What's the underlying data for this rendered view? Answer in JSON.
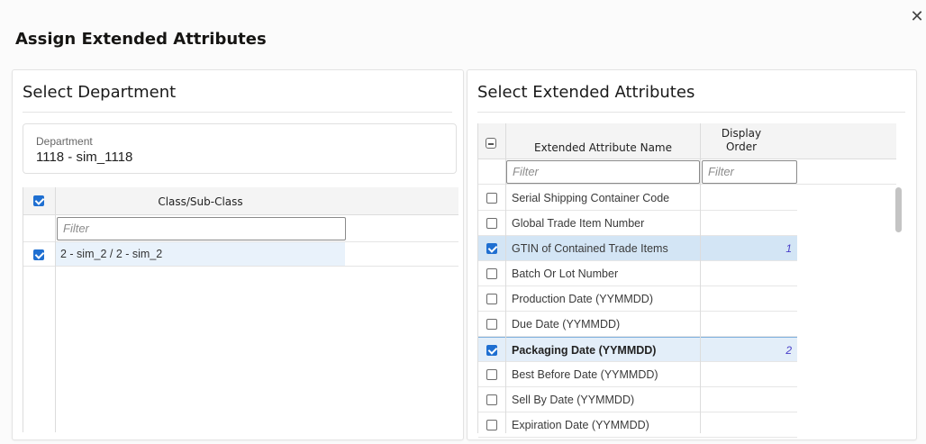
{
  "dialog": {
    "title": "Assign Extended Attributes",
    "close_icon": "close-icon"
  },
  "left_panel": {
    "title": "Select Department",
    "department": {
      "label": "Department",
      "value": "1118 - sim_1118"
    },
    "table": {
      "header_checkbox_checked": true,
      "column_header": "Class/Sub-Class",
      "filter_placeholder": "Filter",
      "rows": [
        {
          "checked": true,
          "label": "2 - sim_2 / 2 - sim_2"
        }
      ]
    }
  },
  "right_panel": {
    "title": "Select Extended Attributes",
    "table": {
      "header_checkbox": "partial",
      "col_name": "Extended Attribute Name",
      "col_order": "Display Order",
      "col_order_line1": "Display",
      "col_order_line2": "Order",
      "filter_name_placeholder": "Filter",
      "filter_order_placeholder": "Filter",
      "rows": [
        {
          "label": "Serial Shipping Container Code",
          "checked": false,
          "order": ""
        },
        {
          "label": "Global Trade Item Number",
          "checked": false,
          "order": ""
        },
        {
          "label": "GTIN of Contained Trade Items",
          "checked": true,
          "order": "1"
        },
        {
          "label": "Batch Or Lot Number",
          "checked": false,
          "order": ""
        },
        {
          "label": "Production Date (YYMMDD)",
          "checked": false,
          "order": ""
        },
        {
          "label": "Due Date (YYMMDD)",
          "checked": false,
          "order": ""
        },
        {
          "label": "Packaging Date (YYMMDD)",
          "checked": true,
          "order": "2"
        },
        {
          "label": "Best Before Date (YYMMDD)",
          "checked": false,
          "order": ""
        },
        {
          "label": "Sell By Date (YYMMDD)",
          "checked": false,
          "order": ""
        },
        {
          "label": "Expiration Date (YYMMDD)",
          "checked": false,
          "order": ""
        }
      ]
    }
  },
  "colors": {
    "accent": "#1f6fd1",
    "row_selected": "#d3e5f5",
    "order_text": "#4a3fc9"
  }
}
